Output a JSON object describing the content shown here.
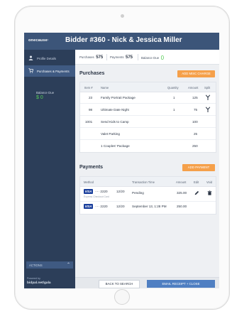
{
  "app": {
    "logo": "onecause·",
    "title": "Bidder #360 - Nick & Jessica Miller"
  },
  "sidebar": {
    "items": [
      {
        "label": "Profile Details",
        "icon": "person-icon",
        "active": false
      },
      {
        "label": "Purchases & Payments",
        "icon": "cart-icon",
        "active": true
      }
    ],
    "balance_label": "Balance Due",
    "balance_value": "$ 0",
    "actions_label": "ACTIONS",
    "powered_by": "Powered by",
    "url": "bidpal.net/gala"
  },
  "summary": {
    "purchases_label": "Purchases",
    "purchases_value": "575",
    "payments_label": "Payments",
    "payments_value": "575",
    "balance_label": "Balance Due",
    "balance_value": "0"
  },
  "purchases": {
    "title": "Purchases",
    "add_button": "ADD MISC CHARGE",
    "columns": [
      "Item #",
      "Name",
      "Quantity",
      "Amount",
      "Split"
    ],
    "rows": [
      {
        "item": "23",
        "name": "Family Portrait Package",
        "qty": "1",
        "amount": "125",
        "split": true
      },
      {
        "item": "98",
        "name": "Ultimate Date Night",
        "qty": "1",
        "amount": "75",
        "split": true
      },
      {
        "item": "1001",
        "name": "Send Kids to Camp",
        "qty": "",
        "amount": "100",
        "split": false
      },
      {
        "item": "",
        "name": "Valet Parking",
        "qty": "",
        "amount": "25",
        "split": false
      },
      {
        "item": "",
        "name": "1 Couples' Package",
        "qty": "",
        "amount": "250",
        "split": false
      }
    ]
  },
  "payments": {
    "title": "Payments",
    "add_button": "ADD PAYMENT",
    "columns": [
      "Method",
      "Transaction Time",
      "Amount",
      "Edit",
      "Void"
    ],
    "rows": [
      {
        "card": "VISA",
        "number": "···· 2220",
        "exp": "12/20",
        "sub": "Express Checkout Card",
        "time": "Pending",
        "amount": "325.00",
        "editable": true
      },
      {
        "card": "VISA",
        "number": "···· 2220",
        "exp": "12/20",
        "sub": "",
        "time": "September 13, 1:28 PM",
        "amount": "250.00",
        "editable": false
      }
    ]
  },
  "footer": {
    "back_label": "BACK TO SEARCH",
    "email_label": "EMAIL RECEIPT + CLOSE"
  },
  "colors": {
    "header": "#3c5579",
    "sidebar": "#2c3e59",
    "accent_orange": "#f5a04a",
    "primary_blue": "#4f7fc2",
    "balance_green": "#55cc55"
  }
}
